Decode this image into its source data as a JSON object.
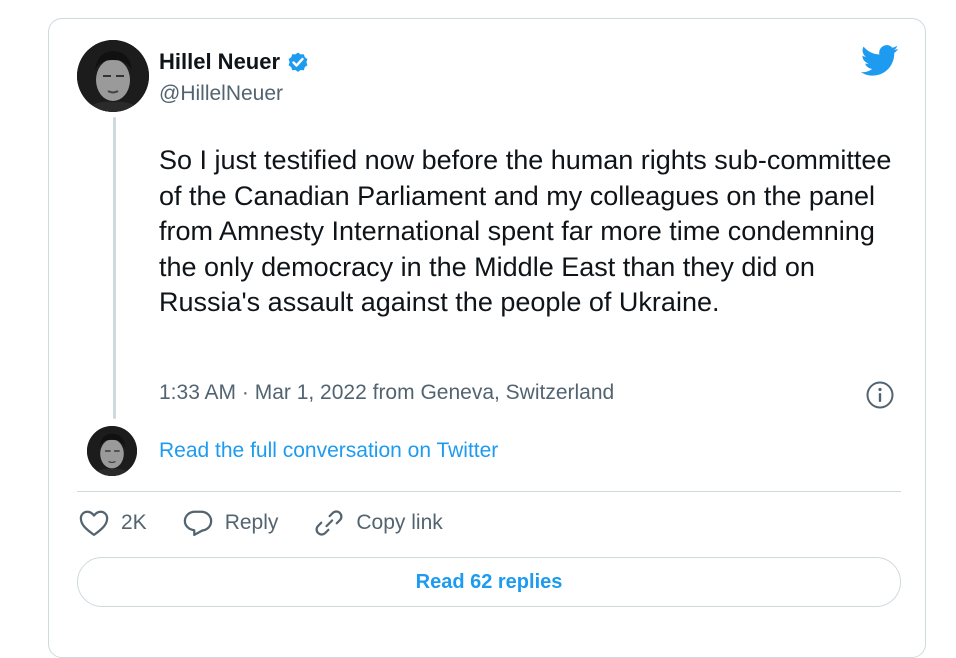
{
  "author": {
    "display_name": "Hillel Neuer",
    "handle": "@HillelNeuer",
    "verified": true
  },
  "tweet": {
    "text": "So I just testified now before the human rights sub-committee of the Canadian Parliament and my colleagues on the panel from Amnesty International spent far more time condemning the only democracy in the Middle East than they did on Russia's assault against the people of Ukraine.",
    "timestamp": "1:33 AM · Mar 1, 2022 from Geneva, Switzerland"
  },
  "conversation": {
    "link_label": "Read the full conversation on Twitter"
  },
  "actions": {
    "like_count": "2K",
    "reply_label": "Reply",
    "copy_link_label": "Copy link"
  },
  "replies_button": {
    "label": "Read 62 replies"
  },
  "colors": {
    "accent": "#1d9bf0",
    "text_primary": "#0f1419",
    "text_secondary": "#536471",
    "border": "#cfd9de"
  },
  "icons": {
    "brand": "twitter-bird-icon",
    "verified": "verified-badge-icon",
    "info": "info-icon",
    "like": "heart-icon",
    "reply": "speech-bubble-icon",
    "copy_link": "link-icon"
  }
}
